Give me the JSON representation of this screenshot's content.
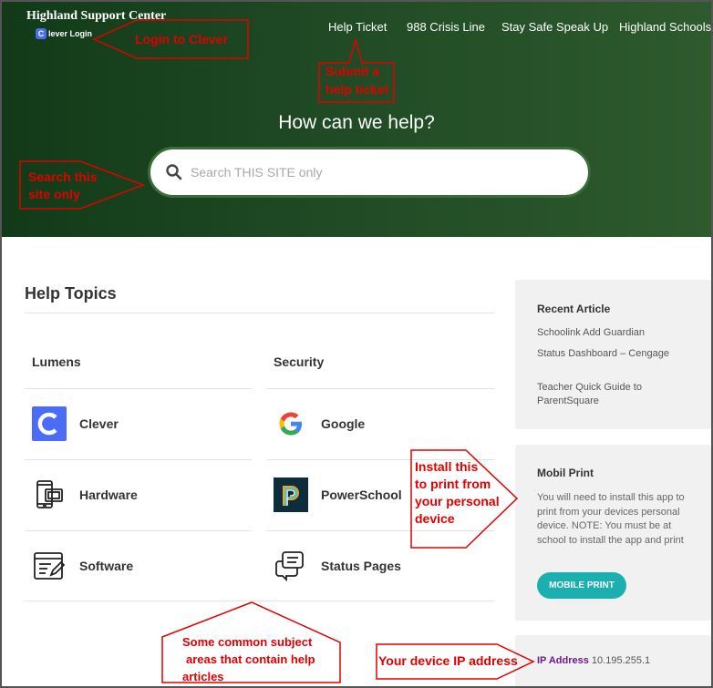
{
  "brand": {
    "title": "Highland Support Center",
    "clever_login": "lever Login"
  },
  "nav": {
    "items": [
      "Help Ticket",
      "988 Crisis Line",
      "Stay Safe Speak Up",
      "Highland Schools"
    ]
  },
  "hero": {
    "title": "How can we help?",
    "search_placeholder": "Search THIS SITE only"
  },
  "topics": {
    "title": "Help Topics",
    "columns": [
      "Lumens",
      "Security"
    ],
    "items": [
      {
        "label": "Clever",
        "icon": "clever-logo-icon"
      },
      {
        "label": "Google",
        "icon": "google-logo-icon"
      },
      {
        "label": "Hardware",
        "icon": "hardware-devices-icon"
      },
      {
        "label": "PowerSchool",
        "icon": "powerschool-logo-icon"
      },
      {
        "label": "Software",
        "icon": "software-edit-icon"
      },
      {
        "label": "Status Pages",
        "icon": "chat-bubbles-icon"
      }
    ]
  },
  "sidebar": {
    "recent": {
      "title": "Recent Article",
      "articles": [
        "Schoolink Add Guardian",
        "Status Dashboard – Cengage",
        "Teacher Quick Guide to ParentSquare"
      ]
    },
    "mobil_print": {
      "title": "Mobil Print",
      "text": "You will need to install this app to print from your devices personal device. NOTE: You must be at school to install the app and print",
      "button": "MOBILE PRINT"
    },
    "ip": {
      "label": "IP Address",
      "value": "10.195.255.1"
    }
  },
  "annotations": {
    "login": "Login to Clever",
    "ticket": [
      "Submit a",
      "help ticket"
    ],
    "search": [
      "Search this",
      "site only"
    ],
    "install": [
      "Install this",
      "to print from",
      "your personal",
      "device"
    ],
    "subjects": [
      "Some common subject",
      "areas that contain help",
      "articles"
    ],
    "ip": "Your device IP address",
    "color": "#e00000"
  },
  "colors": {
    "hero_dark": "#123a18",
    "hero_light": "#2e5a2e",
    "button": "#1ab0b0",
    "ip_label": "#6a1b8a",
    "clever_blue": "#4a6cf7"
  }
}
